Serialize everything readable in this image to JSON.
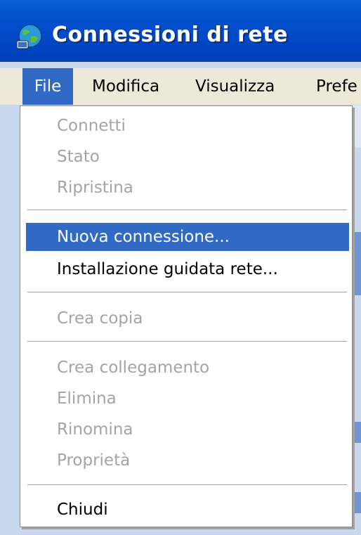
{
  "window": {
    "title": "Connessioni di rete",
    "icon": "network-globe-icon"
  },
  "menubar": {
    "items": [
      "File",
      "Modifica",
      "Visualizza",
      "Prefe"
    ]
  },
  "file_menu": {
    "items": [
      {
        "label": "Connetti",
        "enabled": false
      },
      {
        "label": "Stato",
        "enabled": false
      },
      {
        "label": "Ripristina",
        "enabled": false
      },
      {
        "label": "Nuova connessione...",
        "enabled": true,
        "highlighted": true
      },
      {
        "label": "Installazione guidata rete...",
        "enabled": true
      },
      {
        "label": "Crea copia",
        "enabled": false
      },
      {
        "label": "Crea collegamento",
        "enabled": false
      },
      {
        "label": "Elimina",
        "enabled": false
      },
      {
        "label": "Rinomina",
        "enabled": false
      },
      {
        "label": "Proprietà",
        "enabled": false
      },
      {
        "label": "Chiudi",
        "enabled": true
      }
    ]
  },
  "colors": {
    "title_bar": "#0049c8",
    "highlight": "#316ac5",
    "menu_bar": "#ece9d8",
    "disabled_text": "#a4a4a4"
  }
}
